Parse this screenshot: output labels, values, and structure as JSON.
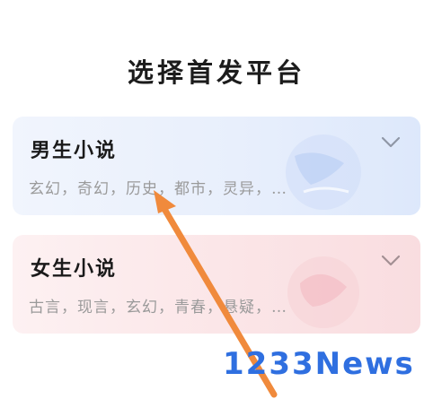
{
  "page": {
    "title": "选择首发平台"
  },
  "cards": {
    "male": {
      "title": "男生小说",
      "genres": "玄幻，奇幻，历史，都市，灵异，…",
      "chevron_icon": "chevron-down-icon",
      "accent": "#dde8fb"
    },
    "female": {
      "title": "女生小说",
      "genres": "古言，现言，玄幻，青春，悬疑，…",
      "chevron_icon": "chevron-down-icon",
      "accent": "#f9dde0"
    }
  },
  "watermark": {
    "text": "1233News"
  },
  "annotation": {
    "arrow_color": "#f08a3c"
  }
}
